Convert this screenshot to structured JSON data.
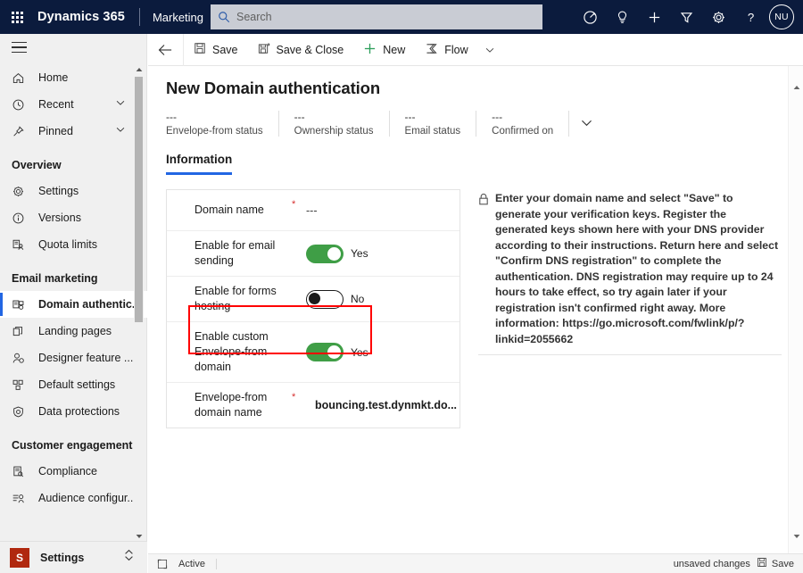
{
  "topnav": {
    "waffle_title": "App launcher",
    "brand": "Dynamics 365",
    "app_name": "Marketing",
    "search_placeholder": "Search",
    "icons": [
      {
        "name": "relevance-search-icon",
        "label": "Relevance search"
      },
      {
        "name": "lightbulb-icon",
        "label": "Insights"
      },
      {
        "name": "plus-icon",
        "label": "New"
      },
      {
        "name": "filter-icon",
        "label": "Filter"
      },
      {
        "name": "gear-icon",
        "label": "Settings"
      },
      {
        "name": "help-icon",
        "label": "Help"
      }
    ],
    "avatar_initials": "NU"
  },
  "sidebar": {
    "top_items": [
      {
        "label": "Home",
        "icon": "home-icon",
        "chevron": false
      },
      {
        "label": "Recent",
        "icon": "clock-icon",
        "chevron": true
      },
      {
        "label": "Pinned",
        "icon": "pin-icon",
        "chevron": true
      }
    ],
    "groups": [
      {
        "title": "Overview",
        "items": [
          {
            "label": "Settings",
            "icon": "gear-icon",
            "selected": false
          },
          {
            "label": "Versions",
            "icon": "info-circle-icon",
            "selected": false
          },
          {
            "label": "Quota limits",
            "icon": "quota-icon",
            "selected": false
          }
        ]
      },
      {
        "title": "Email marketing",
        "items": [
          {
            "label": "Domain authentic...",
            "icon": "domain-auth-icon",
            "selected": true
          },
          {
            "label": "Landing pages",
            "icon": "pages-icon",
            "selected": false
          },
          {
            "label": "Designer feature ...",
            "icon": "person-gear-icon",
            "selected": false
          },
          {
            "label": "Default settings",
            "icon": "blocks-icon",
            "selected": false
          },
          {
            "label": "Data protections",
            "icon": "shield-icon",
            "selected": false
          }
        ]
      },
      {
        "title": "Customer engagement",
        "items": [
          {
            "label": "Compliance",
            "icon": "compliance-icon",
            "selected": false
          },
          {
            "label": "Audience configur...",
            "icon": "audience-icon",
            "selected": false
          }
        ]
      }
    ],
    "app_switcher": {
      "tile_letter": "S",
      "label": "Settings"
    }
  },
  "commandbar": {
    "back_label": "Back",
    "buttons": [
      {
        "label": "Save",
        "icon": "save-icon"
      },
      {
        "label": "Save & Close",
        "icon": "save-close-icon"
      },
      {
        "label": "New",
        "icon": "plus-icon"
      },
      {
        "label": "Flow",
        "icon": "flow-icon"
      }
    ]
  },
  "form": {
    "title": "New Domain authentication",
    "header_fields": [
      {
        "value": "---",
        "label": "Envelope-from status"
      },
      {
        "value": "---",
        "label": "Ownership status"
      },
      {
        "value": "---",
        "label": "Email status"
      },
      {
        "value": "---",
        "label": "Confirmed on"
      }
    ],
    "tabs": [
      {
        "label": "Information",
        "active": true
      }
    ],
    "rows": [
      {
        "label": "Domain name",
        "required": "*",
        "type": "text",
        "value": "---",
        "highlighted": false
      },
      {
        "label": "Enable for email sending",
        "required": "",
        "type": "toggle",
        "toggle_state": "on",
        "value": "Yes",
        "highlighted": false
      },
      {
        "label": "Enable for forms hosting",
        "required": "",
        "type": "toggle",
        "toggle_state": "off",
        "value": "No",
        "highlighted": false
      },
      {
        "label": "Enable custom Envelope-from domain",
        "required": "",
        "type": "toggle",
        "toggle_state": "on",
        "value": "Yes",
        "highlighted": true
      },
      {
        "label": "Envelope-from domain name",
        "required": "*",
        "type": "text-bold",
        "value": "bouncing.test.dynmkt.do...",
        "highlighted": false
      }
    ],
    "info_panel": {
      "icon": "lock-icon",
      "text": "Enter your domain name and select \"Save\" to generate your verification keys. Register the generated keys shown here with your DNS provider according to their instructions. Return here and select \"Confirm DNS registration\" to complete the authentication. DNS registration may require up to 24 hours to take effect, so try again later if your registration isn't confirmed right away. More information: https://go.microsoft.com/fwlink/p/?linkid=2055662"
    }
  },
  "footer": {
    "expand_icon": "expand-icon",
    "status": "Active",
    "unsaved": "unsaved changes",
    "save_label": "Save",
    "save_icon": "save-icon"
  },
  "colors": {
    "nav_bg": "#0b1b3d",
    "accent_blue": "#2266e3",
    "toggle_green": "#3f9e46",
    "annotation_red": "#ff0000",
    "app_tile_red": "#b0280f"
  }
}
